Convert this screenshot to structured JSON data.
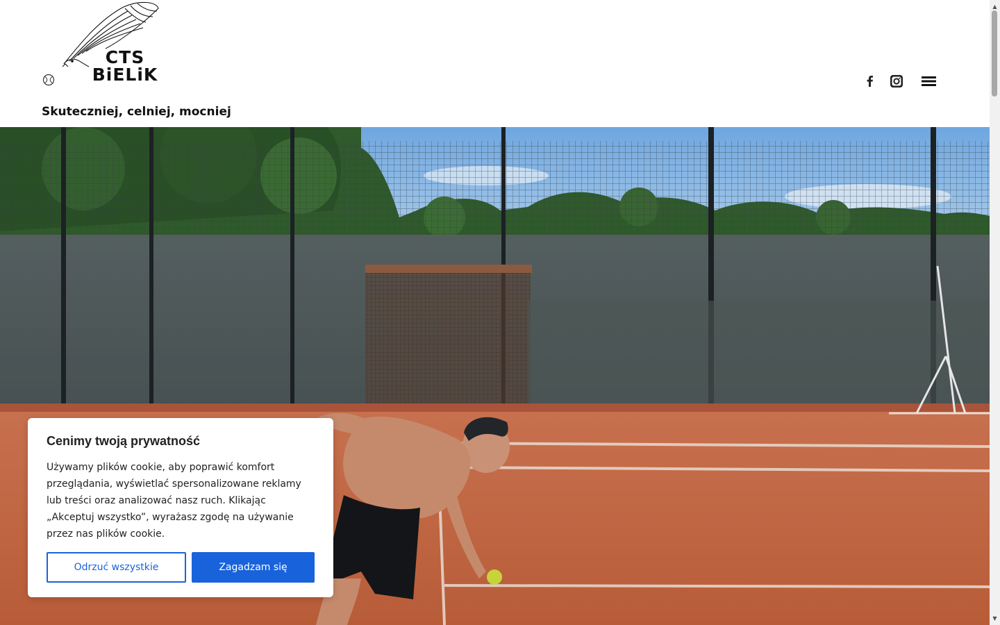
{
  "header": {
    "logo_line1": "CTS",
    "logo_line2": "BiELiK",
    "tagline": "Skuteczniej, celniej, mocniej",
    "icons": [
      "tennis-ball-icon",
      "facebook-icon",
      "instagram-icon",
      "hamburger-menu-icon"
    ]
  },
  "cookie_banner": {
    "title": "Cenimy twoją prywatność",
    "text": "Używamy plików cookie, aby poprawić komfort przeglądania, wyświetlać spersonalizowane reklamy lub treści oraz analizować nasz ruch. Klikając „Akceptuj wszystko”, wyrażasz zgodę na używanie przez nas plików cookie.",
    "reject_label": "Odrzuć wszystkie",
    "accept_label": "Zagadzam się"
  },
  "colors": {
    "accent": "#1863dc",
    "clay": "#c96a45",
    "sky": "#7fb0e3"
  }
}
